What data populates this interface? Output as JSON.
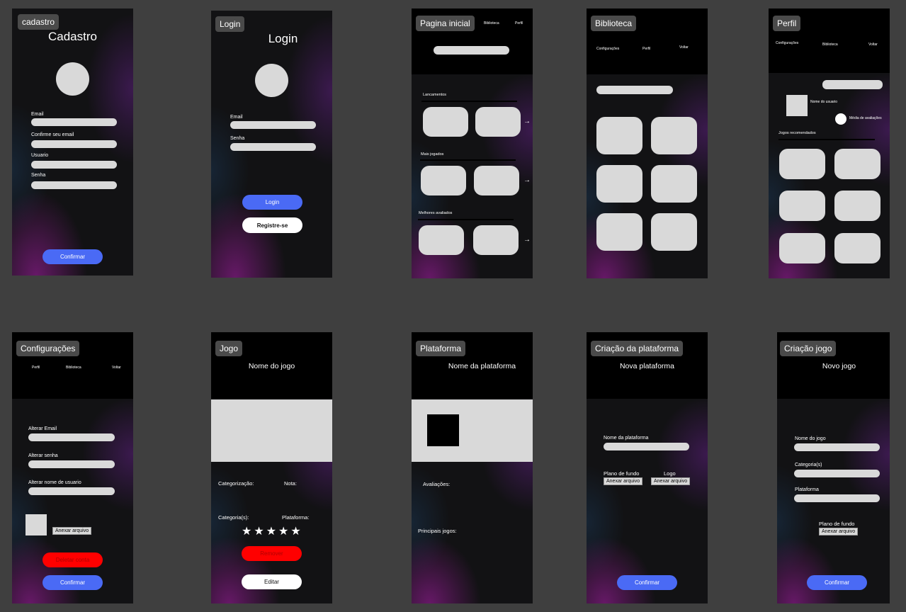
{
  "cadastro": {
    "tag": "cadastro",
    "title": "Cadastro",
    "email": "Email",
    "confirm_email": "Confirme seu email",
    "user": "Usuario",
    "password": "Senha",
    "confirm": "Confirmar"
  },
  "login": {
    "tag": "Login",
    "title": "Login",
    "email": "Email",
    "password": "Senha",
    "login_btn": "Login",
    "register_btn": "Registre-se"
  },
  "home": {
    "tag": "Pagina inicial",
    "nav_library": "Biblioteca",
    "nav_profile": "Perfil",
    "section_releases": "Lancamentos",
    "section_most_played": "Mais jogados",
    "section_top_rated": "Melhores avaliados"
  },
  "library": {
    "tag": "Biblioteca",
    "nav_settings": "Configurações",
    "nav_profile": "Perfil",
    "nav_back": "Voltar"
  },
  "profile": {
    "tag": "Perfil",
    "nav_settings": "Configurações",
    "nav_library": "Biblioteca",
    "nav_back": "Voltar",
    "username": "Nome do usuario",
    "rating_avg": "Média de avaliações",
    "recommended": "Jogos recomendados"
  },
  "settings": {
    "tag": "Configurações",
    "nav_profile": "Perfil",
    "nav_library": "Biblioteca",
    "nav_back": "Voltar",
    "change_email": "Alterar Email",
    "change_password": "Alterar senha",
    "change_username": "Alterar nome de usuario",
    "attach": "Anexar arquivo",
    "delete_account": "Deletar conta",
    "confirm": "Confirmar"
  },
  "game": {
    "tag": "Jogo",
    "title": "Nome do jogo",
    "categorization": "Categorização:",
    "score": "Nota:",
    "categories": "Categoria(s):",
    "platform": "Plataforma:",
    "stars": "★★★★★",
    "remove": "Remover",
    "edit": "Editar"
  },
  "platform": {
    "tag": "Plataforma",
    "title": "Nome da plataforma",
    "ratings": "Avaliações:",
    "main_games": "Principais jogos:"
  },
  "create_platform": {
    "tag": "Criação da plataforma",
    "title": "Nova plataforma",
    "name": "Nome da plataforma",
    "background": "Plano de fundo",
    "logo": "Logo",
    "attach": "Anexar arquivo",
    "confirm": "Confirmar"
  },
  "create_game": {
    "tag": "Criação jogo",
    "title": "Novo jogo",
    "name": "Nome do jogo",
    "categories": "Categoria(s)",
    "platform": "Plataforma",
    "background": "Plano de fundo",
    "attach": "Anexar arquivo",
    "confirm": "Confirmar"
  }
}
